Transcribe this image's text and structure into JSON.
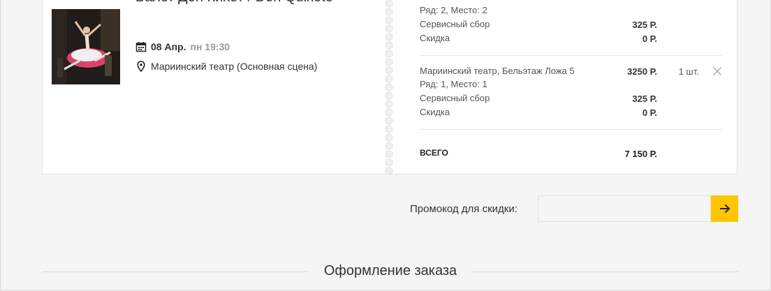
{
  "event": {
    "title": "Балет Дон Кихот / Don Quixote",
    "date": "08 Апр.",
    "time": "пн 19:30",
    "venue": "Мариинский театр (Основная сцена)"
  },
  "tickets": [
    {
      "place_line": "Ряд: 2, Место: 2",
      "service_label": "Сервисный сбор",
      "service_fee": "325 Р.",
      "discount_label": "Скидка",
      "discount": "0 Р."
    },
    {
      "section": "Мариинский театр, Бельэтаж Ложа 5",
      "price": "3250 Р.",
      "qty": "1 шт.",
      "place_line": "Ряд: 1, Место: 1",
      "service_label": "Сервисный сбор",
      "service_fee": "325 Р.",
      "discount_label": "Скидка",
      "discount": "0 Р."
    }
  ],
  "summary": {
    "total_label": "ВСЕГО",
    "total_value": "7 150 Р."
  },
  "promo": {
    "label": "Промокод для скидки:",
    "placeholder": "",
    "submit_icon": "arrow-right-icon"
  },
  "checkout": {
    "section_title": "Оформление заказа"
  },
  "colors": {
    "accent": "#ffc600",
    "background": "#f5f5f5",
    "card": "#ffffff",
    "muted_time": "#9a9a9a"
  }
}
